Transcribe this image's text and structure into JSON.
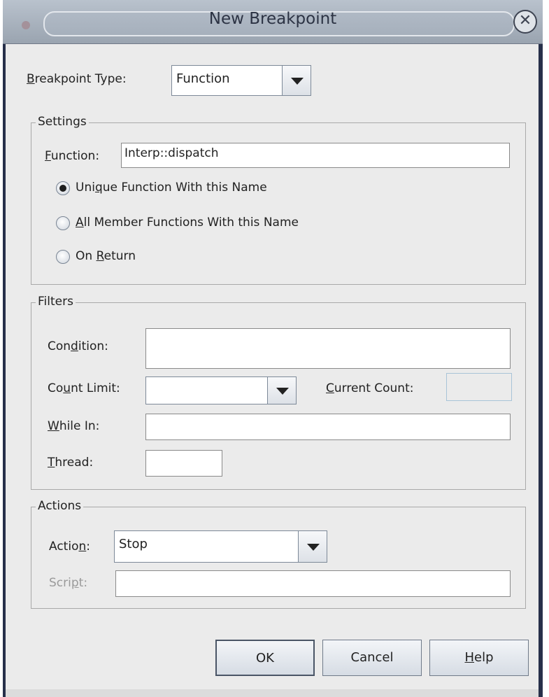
{
  "window": {
    "title": "New Breakpoint"
  },
  "breakpoint_type": {
    "label": "Breakpoint Type:",
    "value": "Function"
  },
  "settings": {
    "title": "Settings",
    "function_label": "Function:",
    "function_value": "Interp::dispatch",
    "radios": [
      {
        "label": "Unique Function With this Name",
        "checked": true
      },
      {
        "label": "All Member Functions With this Name",
        "checked": false
      },
      {
        "label": "On Return",
        "checked": false
      }
    ]
  },
  "filters": {
    "title": "Filters",
    "condition_label": "Condition:",
    "condition_value": "",
    "count_limit_label": "Count Limit:",
    "count_limit_value": "",
    "current_count_label": "Current Count:",
    "current_count_value": "",
    "while_in_label": "While In:",
    "while_in_value": "",
    "thread_label": "Thread:",
    "thread_value": ""
  },
  "actions": {
    "title": "Actions",
    "action_label": "Action:",
    "action_value": "Stop",
    "script_label": "Script:",
    "script_value": ""
  },
  "buttons": {
    "ok": "OK",
    "cancel": "Cancel",
    "help": "Help"
  },
  "colors": {
    "titlebar": "#a6b0bc",
    "dialog_bg": "#ebebeb",
    "frame": "#27304a"
  },
  "icons": {
    "close": "close-icon"
  }
}
